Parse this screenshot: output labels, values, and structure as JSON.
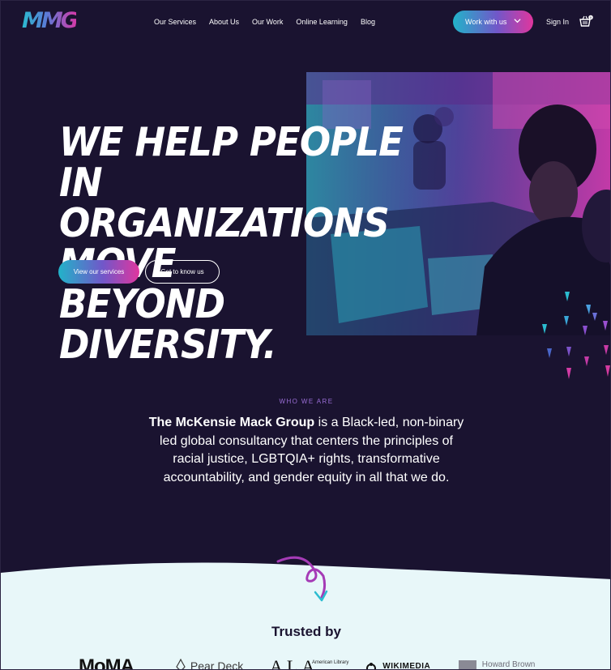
{
  "brand": {
    "logo_text": "MMG"
  },
  "nav": {
    "items": [
      "Our Services",
      "About Us",
      "Our Work",
      "Online Learning",
      "Blog"
    ],
    "cta_label": "Work with us",
    "sign_in": "Sign In",
    "cart_count": "0"
  },
  "hero": {
    "headline_lines": [
      "WE HELP PEOPLE IN",
      "ORGANIZATIONS MOVE",
      "BEYOND DIVERSITY."
    ],
    "primary_button": "View our services",
    "secondary_button": "Get to know us"
  },
  "about": {
    "label": "WHO WE ARE",
    "company_name": "The McKensie Mack Group",
    "body": "is a Black-led, non-binary led global consultancy that centers the principles of racial justice, LGBTQIA+ rights, transformative accountability, and gender equity in all that we do."
  },
  "trusted": {
    "heading": "Trusted by",
    "logos": {
      "moma": "MoMA",
      "pear": "Pear Deck",
      "ala": "ALA",
      "ala_sub": "American Library",
      "wiki": "WIKIMEDIA",
      "hb": "Howard Brown"
    }
  },
  "colors": {
    "background": "#1a1330",
    "accent_teal": "#22b3c9",
    "accent_magenta": "#e0369e",
    "light_section": "#e8f7f9",
    "label_purple": "#9a6ed6"
  }
}
